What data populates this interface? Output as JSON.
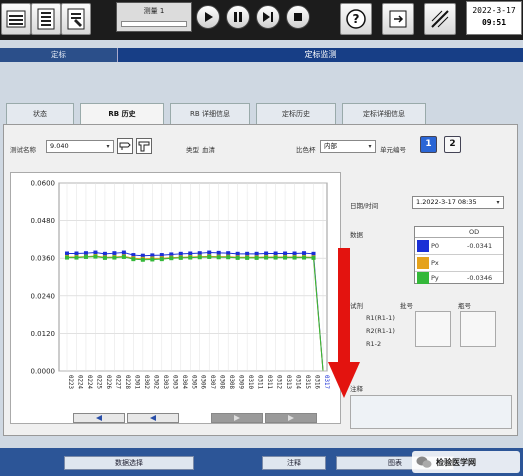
{
  "toolbar": {
    "measure_label": "测量 1",
    "date": "2022-3-17",
    "time": "09:51"
  },
  "modes": {
    "qc": "定标",
    "qc_monitor": "定标监测"
  },
  "tabs": [
    {
      "label": "状态"
    },
    {
      "label": "RB 历史"
    },
    {
      "label": "RB 详细信息"
    },
    {
      "label": "定标历史"
    },
    {
      "label": "定标详细信息"
    }
  ],
  "filters": {
    "test_name_label": "测试名称",
    "test_name_value": "9.040",
    "category_label": "类型",
    "category_value": "血清",
    "cup_label": "比色杯",
    "cup_value": "内部",
    "unit_no_label": "单元编号",
    "unit_buttons": [
      "1",
      "2"
    ]
  },
  "chart_data": {
    "type": "line",
    "y_ticks": [
      "0.0600",
      "0.0480",
      "0.0360",
      "0.0240",
      "0.0120",
      "0.0000"
    ],
    "ylim": [
      0,
      0.06
    ],
    "categories": [
      "0223",
      "0224",
      "0224",
      "0225",
      "0226",
      "0227",
      "0228",
      "0301",
      "0302",
      "0302",
      "0303",
      "0303",
      "0304",
      "0305",
      "0306",
      "0307",
      "0308",
      "0308",
      "0309",
      "0310",
      "0311",
      "0311",
      "0312",
      "0313",
      "0314",
      "0315",
      "0316",
      "0317"
    ],
    "last_label_highlight": true,
    "series": [
      {
        "name": "P0",
        "color": "#1a2fd6",
        "values": [
          0.0375,
          0.0375,
          0.0376,
          0.0378,
          0.0374,
          0.0376,
          0.0378,
          0.037,
          0.0368,
          0.0369,
          0.037,
          0.0372,
          0.0374,
          0.0375,
          0.0376,
          0.0378,
          0.0377,
          0.0376,
          0.0374,
          0.0374,
          0.0374,
          0.0375,
          0.0375,
          0.0375,
          0.0375,
          0.0376,
          0.0374,
          0.0002
        ]
      },
      {
        "name": "Px",
        "color": "#e5a21a",
        "values": [
          0.0364,
          0.0364,
          0.0365,
          0.0367,
          0.0363,
          0.0364,
          0.0366,
          0.036,
          0.0358,
          0.0359,
          0.036,
          0.0362,
          0.0363,
          0.0364,
          0.0365,
          0.0366,
          0.0365,
          0.0365,
          0.0363,
          0.0363,
          0.0363,
          0.0364,
          0.0364,
          0.0364,
          0.0364,
          0.0364,
          0.0363,
          0.0001
        ]
      },
      {
        "name": "Py",
        "color": "#34b83a",
        "values": [
          0.0362,
          0.0362,
          0.0364,
          0.0365,
          0.0361,
          0.0362,
          0.0364,
          0.0357,
          0.0355,
          0.0356,
          0.0357,
          0.036,
          0.0361,
          0.0362,
          0.0363,
          0.0364,
          0.0363,
          0.0363,
          0.0361,
          0.0361,
          0.0361,
          0.0362,
          0.0362,
          0.0362,
          0.0362,
          0.0362,
          0.0361,
          0.0001
        ]
      }
    ]
  },
  "details": {
    "datetime_label": "日期/时间",
    "datetime_value": "1.2022-3-17 08:35",
    "data_label": "数据",
    "od_header": "OD",
    "legend": [
      {
        "name": "P0",
        "value": "-0.0341",
        "color": "#1a2fd6"
      },
      {
        "name": "Px",
        "value": "",
        "color": "#e5a21a"
      },
      {
        "name": "Py",
        "value": "-0.0346",
        "color": "#34b83a"
      }
    ],
    "reagent_label": "试剂",
    "lot_label": "批号",
    "bottle_label": "瓶号",
    "reagent_rows": [
      "R1(R1-1)",
      "R2(R1-1)",
      "R1-2"
    ],
    "comment_label": "注释"
  },
  "bottom": {
    "data_select": "数据选择",
    "comment": "注释",
    "print": "图表",
    "watermark": "检验医学网"
  },
  "colors": {
    "header_blue": "#173e86",
    "bottom_blue": "#2c5597",
    "arrow_red": "#e3130f"
  }
}
